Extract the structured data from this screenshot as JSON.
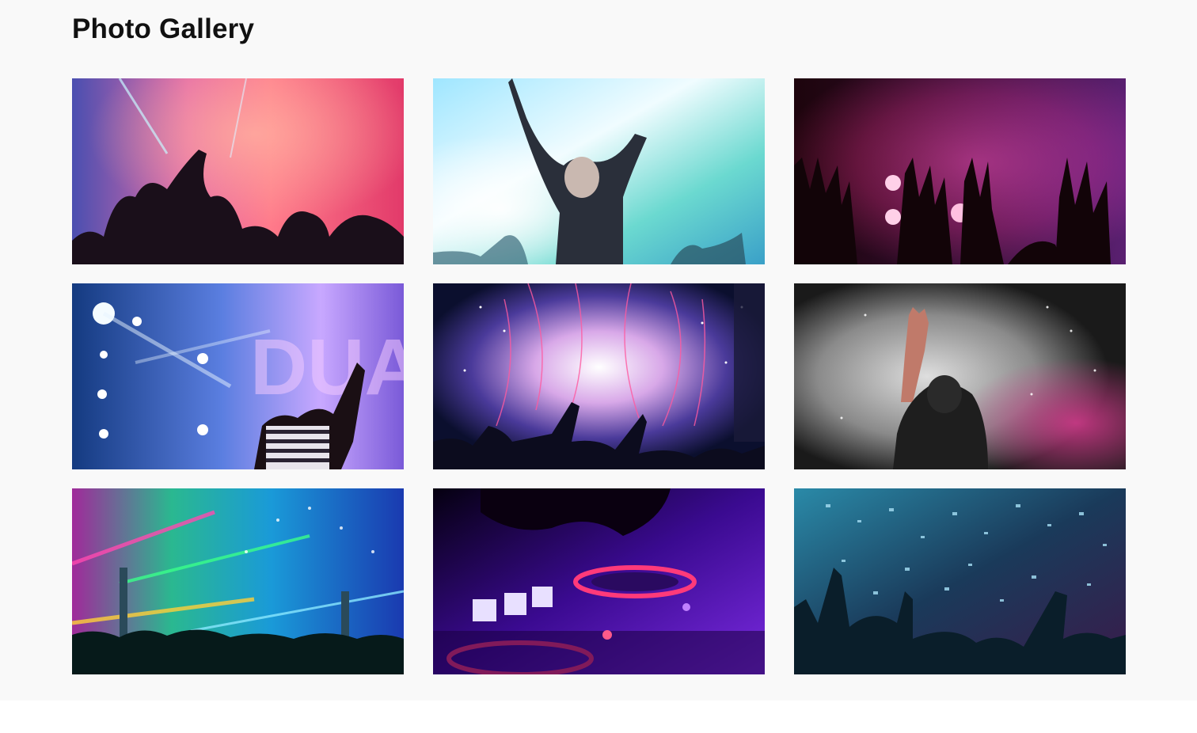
{
  "page": {
    "title": "Photo Gallery"
  },
  "gallery": {
    "photos": [
      {
        "subject": "crowd with raised hands under pink stage smoke",
        "palette": [
          "#5b3a9e",
          "#f25a8a",
          "#ff8a7a",
          "#2a1f4a"
        ]
      },
      {
        "subject": "woman dancing with arms raised in cyan haze",
        "palette": [
          "#c8f4ff",
          "#6ad7e8",
          "#3ea6c9",
          "#1d3a4a"
        ]
      },
      {
        "subject": "silhouetted hands against magenta concert lights",
        "palette": [
          "#3a0a1a",
          "#c2286a",
          "#ff7fb5",
          "#7a2aa0"
        ]
      },
      {
        "subject": "woman in striped top waving at blue spotlight stage",
        "palette": [
          "#1a2e6e",
          "#6e8ff0",
          "#c7a0ff",
          "#0d1a40"
        ]
      },
      {
        "subject": "fireworks and confetti over a festival crowd",
        "palette": [
          "#0b1030",
          "#e05fa8",
          "#ffffff",
          "#3b2a80"
        ]
      },
      {
        "subject": "performer with microphone and raised hand in white smoke",
        "palette": [
          "#2a2a2a",
          "#d8d8d8",
          "#b03a7a",
          "#101010"
        ]
      },
      {
        "subject": "rainbow laser lights over a huge festival crowd",
        "palette": [
          "#1a3a9e",
          "#2bd6a0",
          "#ff3aa0",
          "#0a1a30"
        ]
      },
      {
        "subject": "DJ hand on glowing turntable deck",
        "palette": [
          "#1a0040",
          "#6a2ad0",
          "#ff3a80",
          "#3a0a90"
        ]
      },
      {
        "subject": "confetti raining on crowd with raised arms",
        "palette": [
          "#0e2a3a",
          "#2a8aa8",
          "#8ad0e8",
          "#3a1a4a"
        ]
      }
    ]
  }
}
